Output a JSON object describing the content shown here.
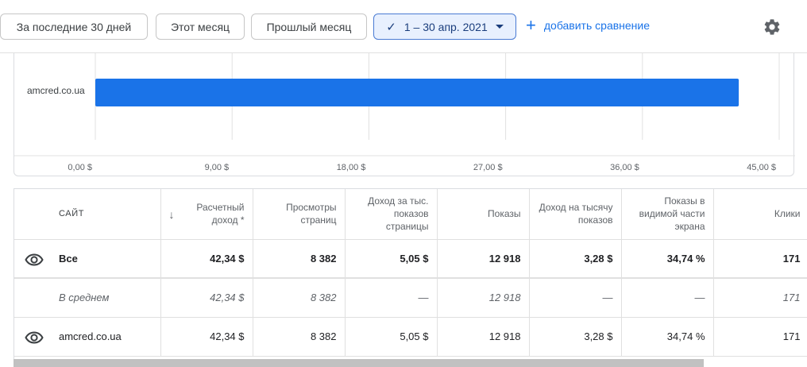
{
  "filters": {
    "chips": [
      "За последние 30 дней",
      "Этот месяц",
      "Прошлый месяц"
    ],
    "active_range": "1 – 30 апр. 2021",
    "add_compare": "добавить сравнение"
  },
  "icons": {
    "settings": "gear-icon",
    "visibility": "eye-icon",
    "sort": "arrow-down-icon",
    "check": "check-icon"
  },
  "colors": {
    "bar": "#1a73e8",
    "link": "#1a73e8",
    "active_chip_bg": "#e8f0fe"
  },
  "chart_data": {
    "type": "bar",
    "orientation": "horizontal",
    "categories": [
      "amcred.co.ua"
    ],
    "values": [
      42.34
    ],
    "xlim": [
      0,
      45
    ],
    "ticks": [
      "0,00 $",
      "9,00 $",
      "18,00 $",
      "27,00 $",
      "36,00 $",
      "45,00 $"
    ],
    "tick_values": [
      0,
      9,
      18,
      27,
      36,
      45
    ],
    "grid": true
  },
  "table": {
    "headers": {
      "site": "САЙТ",
      "revenue": "Расчетный доход *",
      "pageviews": "Просмотры страниц",
      "rpm": "Доход за тыс. показов страницы",
      "impressions": "Показы",
      "impression_rpm": "Доход на тысячу показов",
      "viewable": "Показы в видимой части экрана",
      "clicks": "Клики"
    },
    "rows": [
      {
        "kind": "total",
        "site": "Все",
        "revenue": "42,34 $",
        "pageviews": "8 382",
        "rpm": "5,05 $",
        "impressions": "12 918",
        "impression_rpm": "3,28 $",
        "viewable": "34,74 %",
        "clicks": "171"
      },
      {
        "kind": "avg",
        "site": "В среднем",
        "revenue": "42,34 $",
        "pageviews": "8 382",
        "rpm": "—",
        "impressions": "12 918",
        "impression_rpm": "—",
        "viewable": "—",
        "clicks": "171"
      },
      {
        "kind": "row",
        "site": "amcred.co.ua",
        "revenue": "42,34 $",
        "pageviews": "8 382",
        "rpm": "5,05 $",
        "impressions": "12 918",
        "impression_rpm": "3,28 $",
        "viewable": "34,74 %",
        "clicks": "171"
      }
    ]
  }
}
